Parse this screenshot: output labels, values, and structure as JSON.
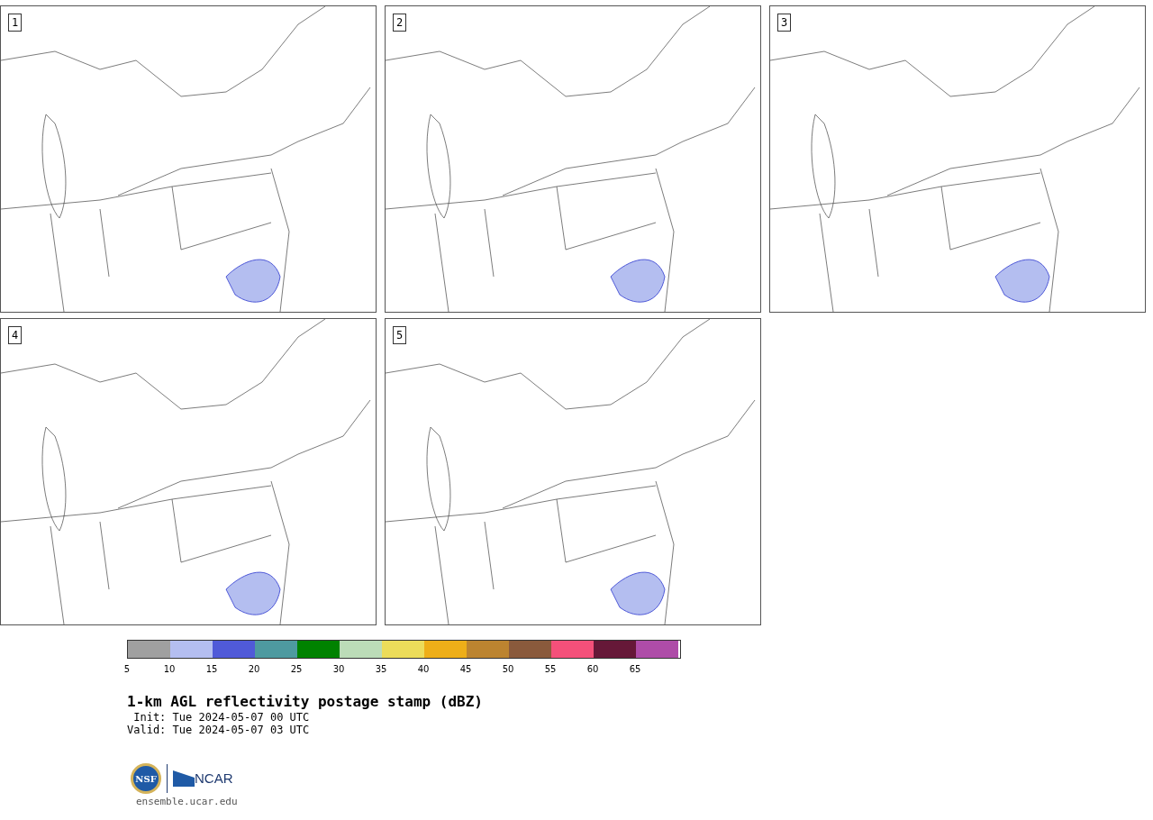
{
  "panels": [
    {
      "label": "1"
    },
    {
      "label": "2"
    },
    {
      "label": "3"
    },
    {
      "label": "4"
    },
    {
      "label": "5"
    }
  ],
  "colorbar": {
    "segments": [
      {
        "color": "#a0a0a0"
      },
      {
        "color": "#b4bef0"
      },
      {
        "color": "#505ad8"
      },
      {
        "color": "#4e9aa0"
      },
      {
        "color": "#008200"
      },
      {
        "color": "#bcdcb8"
      },
      {
        "color": "#ecdc5a"
      },
      {
        "color": "#eeae18"
      },
      {
        "color": "#bc8430"
      },
      {
        "color": "#8a5a3c"
      },
      {
        "color": "#f4507a"
      },
      {
        "color": "#661838"
      },
      {
        "color": "#ae4ca8"
      }
    ],
    "ticks": [
      "5",
      "10",
      "15",
      "20",
      "25",
      "30",
      "35",
      "40",
      "45",
      "50",
      "55",
      "60",
      "65"
    ]
  },
  "title": "1-km AGL reflectivity postage stamp (dBZ)",
  "init": " Init: Tue 2024-05-07 00 UTC",
  "valid": "Valid: Tue 2024-05-07 03 UTC",
  "logos": {
    "nsf": "NSF",
    "ncar": "NCAR"
  },
  "footer": "ensemble.ucar.edu"
}
